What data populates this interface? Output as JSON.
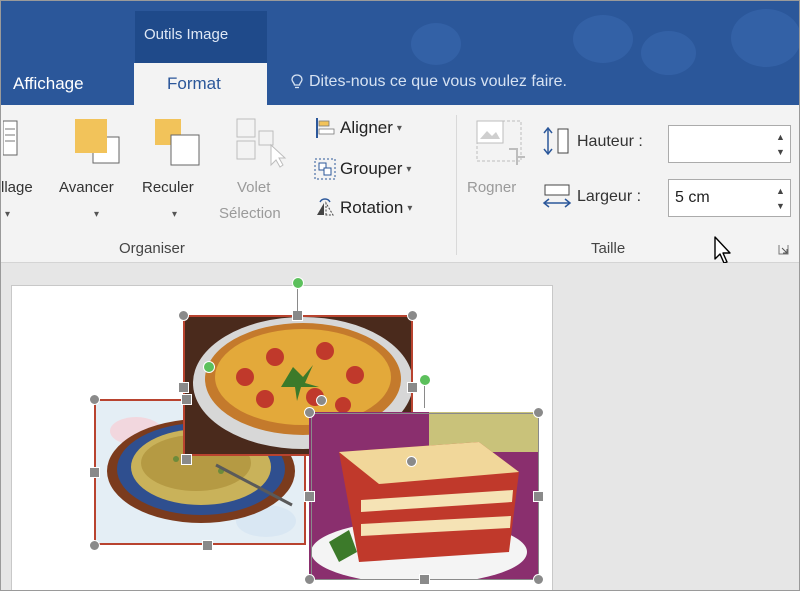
{
  "tabs": {
    "context_group": "Outils Image",
    "affichage": "Affichage",
    "format": "Format",
    "tell_me": "Dites-nous ce que vous voulez faire."
  },
  "organiser": {
    "habillage": "llage",
    "avancer": "Avancer",
    "reculer": "Reculer",
    "volet_line1": "Volet",
    "volet_line2": "Sélection",
    "aligner": "Aligner",
    "grouper": "Grouper",
    "rotation": "Rotation",
    "group_label": "Organiser"
  },
  "taille": {
    "rogner": "Rogner",
    "hauteur_label": "Hauteur :",
    "hauteur_value": "",
    "largeur_label": "Largeur :",
    "largeur_value": "5 cm",
    "group_label": "Taille"
  },
  "colors": {
    "title_bar": "#2b579a",
    "ribbon": "#f3f3f3",
    "selection_border": "#c0392b",
    "rotation_handle": "#5cc05c"
  },
  "icons": [
    "text-wrap-icon",
    "bring-forward-icon",
    "send-backward-icon",
    "selection-pane-icon",
    "align-icon",
    "group-icon",
    "rotate-icon",
    "crop-icon",
    "height-icon",
    "width-icon",
    "dialog-launcher-icon",
    "lightbulb-icon",
    "mouse-cursor-icon"
  ]
}
